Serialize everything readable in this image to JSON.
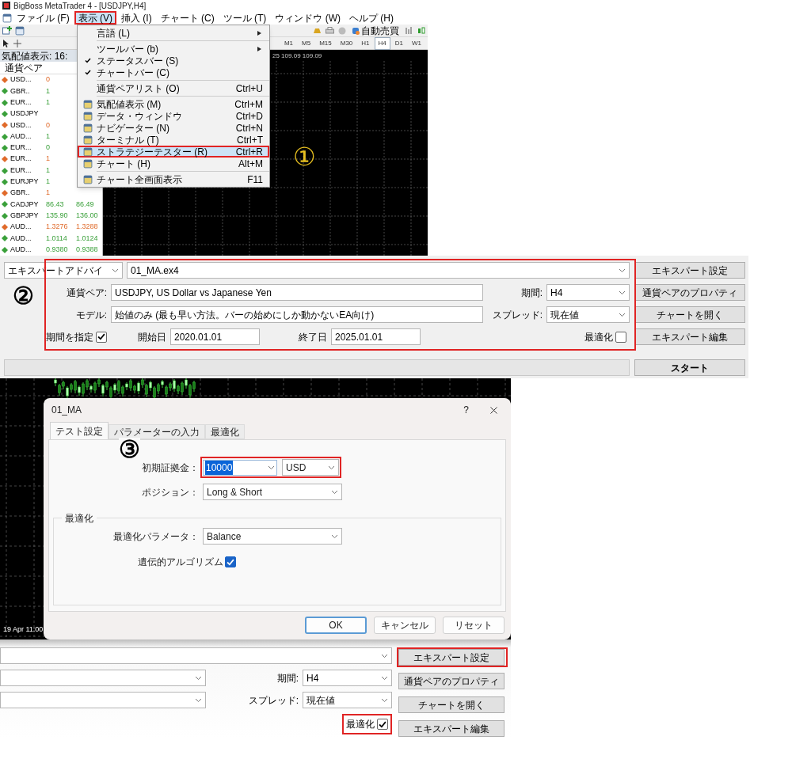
{
  "terminal": {
    "window": {
      "title": "BigBoss MetaTrader 4 - [USDJPY,H4]"
    },
    "menu_bar": [
      {
        "label": "ファイル (F)",
        "highlighted": false
      },
      {
        "label": "表示 (V)",
        "highlighted": true
      },
      {
        "label": "挿入 (I)",
        "highlighted": false
      },
      {
        "label": "チャート (C)",
        "highlighted": false
      },
      {
        "label": "ツール (T)",
        "highlighted": false
      },
      {
        "label": "ウィンドウ (W)",
        "highlighted": false
      },
      {
        "label": "ヘルプ (H)",
        "highlighted": false
      }
    ],
    "toolbar": {
      "auto_trade": "自動売買",
      "timeframes": [
        {
          "label": "M1",
          "selected": false
        },
        {
          "label": "M5",
          "selected": false
        },
        {
          "label": "M15",
          "selected": false
        },
        {
          "label": "M30",
          "selected": false
        },
        {
          "label": "H1",
          "selected": false
        },
        {
          "label": "H4",
          "selected": true
        },
        {
          "label": "D1",
          "selected": false
        },
        {
          "label": "W1",
          "selected": false
        }
      ]
    },
    "market_watch": {
      "title": "気配値表示: 16:",
      "column_1": "通貨ペア",
      "rows": [
        {
          "symbol": "USD...",
          "bid": "0",
          "color": "#e06a2a"
        },
        {
          "symbol": "GBR..",
          "bid": "1",
          "color": "#3aa03a"
        },
        {
          "symbol": "EUR...",
          "bid": "1",
          "color": "#3aa03a"
        },
        {
          "symbol": "USDJPY",
          "color": "#3aa03a"
        },
        {
          "symbol": "USD...",
          "bid": "0",
          "color": "#e06a2a"
        },
        {
          "symbol": "AUD...",
          "bid": "1",
          "color": "#3aa03a"
        },
        {
          "symbol": "EUR...",
          "bid": "0",
          "color": "#3aa03a"
        },
        {
          "symbol": "EUR...",
          "bid": "1",
          "color": "#e06a2a"
        },
        {
          "symbol": "EUR...",
          "bid": "1",
          "color": "#3aa03a"
        },
        {
          "symbol": "EURJPY",
          "bid": "1",
          "color": "#3aa03a"
        },
        {
          "symbol": "GBR..",
          "bid": "1",
          "color": "#e06a2a"
        },
        {
          "symbol": "CADJPY",
          "bid": "86.43",
          "ask": "86.49",
          "color": "#3aa03a"
        },
        {
          "symbol": "GBPJPY",
          "bid": "135.90",
          "ask": "136.00",
          "color": "#3aa03a"
        },
        {
          "symbol": "AUD...",
          "bid": "1.3276",
          "ask": "1.3288",
          "color": "#e06a2a"
        },
        {
          "symbol": "AUD...",
          "bid": "1.0114",
          "ask": "1.0124",
          "color": "#3aa03a"
        },
        {
          "symbol": "AUD...",
          "bid": "0.9380",
          "ask": "0.9388",
          "color": "#3aa03a"
        }
      ]
    },
    "chart": {
      "price_line": "25 109.09 109.09"
    },
    "view_menu": {
      "items": [
        {
          "kind": "submenu",
          "label": "言語 (L)",
          "checked": false,
          "icon": false,
          "selected": false,
          "highlighted": false
        },
        {
          "kind": "separator"
        },
        {
          "kind": "submenu",
          "label": "ツールバー (b)",
          "checked": false,
          "icon": false,
          "selected": false,
          "highlighted": false
        },
        {
          "kind": "item",
          "label": "ステータスバー (S)",
          "checked": true,
          "icon": false,
          "selected": false,
          "highlighted": false
        },
        {
          "kind": "item",
          "label": "チャートバー (C)",
          "checked": true,
          "icon": false,
          "selected": false,
          "highlighted": false
        },
        {
          "kind": "separator"
        },
        {
          "kind": "item",
          "label": "通貨ペアリスト (O)",
          "shortcut": "Ctrl+U",
          "checked": false,
          "icon": false,
          "selected": false,
          "highlighted": false
        },
        {
          "kind": "separator"
        },
        {
          "kind": "item",
          "label": "気配値表示 (M)",
          "shortcut": "Ctrl+M",
          "checked": false,
          "icon": true,
          "selected": false,
          "highlighted": false
        },
        {
          "kind": "item",
          "label": "データ・ウィンドウ",
          "shortcut": "Ctrl+D",
          "checked": false,
          "icon": true,
          "selected": false,
          "highlighted": false
        },
        {
          "kind": "item",
          "label": "ナビゲーター (N)",
          "shortcut": "Ctrl+N",
          "checked": false,
          "icon": true,
          "selected": false,
          "highlighted": false
        },
        {
          "kind": "item",
          "label": "ターミナル (T)",
          "shortcut": "Ctrl+T",
          "checked": false,
          "icon": true,
          "selected": false,
          "highlighted": false
        },
        {
          "kind": "item",
          "label": "ストラテジーテスター (R)",
          "shortcut": "Ctrl+R",
          "checked": false,
          "icon": true,
          "selected": true,
          "highlighted": true
        },
        {
          "kind": "item",
          "label": "チャート (H)",
          "shortcut": "Alt+M",
          "checked": false,
          "icon": true,
          "selected": false,
          "highlighted": false
        },
        {
          "kind": "separator"
        },
        {
          "kind": "item",
          "label": "チャート全画面表示",
          "shortcut": "F11",
          "checked": false,
          "icon": true,
          "selected": false,
          "highlighted": false
        }
      ]
    },
    "marker": "①"
  },
  "tester_panel": {
    "highlighted": true,
    "marker": "②",
    "expert_type": "エキスパートアドバイ",
    "expert": "01_MA.ex4",
    "symbol_label": "通貨ペア:",
    "symbol": "USDJPY, US Dollar vs Japanese Yen",
    "model_label": "モデル:",
    "model": "始値のみ (最も早い方法。バーの始めにしか動かないEA向け)",
    "period_label": "期間:",
    "period": "H4",
    "spread_label": "スプレッド:",
    "spread": "現在値",
    "use_date": {
      "label": "期間を指定",
      "checked": true
    },
    "start_label": "開始日",
    "start": "2020.01.01",
    "end_label": "終了日",
    "end": "2025.01.01",
    "optimization": {
      "label": "最適化",
      "checked": false
    },
    "buttons": [
      "エキスパート設定",
      "通貨ペアのプロパティ",
      "チャートを開く",
      "エキスパート編集"
    ],
    "start_button": "スタート",
    "progress": {
      "level": 0
    }
  },
  "background_chart": {
    "time_label": "19 Apr 11:00"
  },
  "settings_dialog": {
    "title": "01_MA",
    "help": "?",
    "marker": "③",
    "tabs": [
      {
        "label": "テスト設定",
        "selected": true
      },
      {
        "label": "パラメーターの入力",
        "selected": false
      },
      {
        "label": "最適化",
        "selected": false
      }
    ],
    "deposit_label": "初期証拠金：",
    "deposit": "10000",
    "currency": "USD",
    "deposit_highlighted": true,
    "position_label": "ポジション：",
    "position": "Long & Short",
    "group_title": "最適化",
    "opt_param_label": "最適化パラメータ：",
    "opt_param": "Balance",
    "genetic": {
      "label": "遺伝的アルゴリズム",
      "checked": true
    },
    "buttons": [
      {
        "label": "OK",
        "default": true
      },
      {
        "label": "キャンセル",
        "default": false
      },
      {
        "label": "リセット",
        "default": false
      }
    ]
  },
  "tester_panel_after": {
    "period_label": "期間:",
    "period": "H4",
    "spread_label": "スプレッド:",
    "spread": "現在値",
    "optimization": {
      "label": "最適化",
      "checked": true,
      "highlighted": true
    },
    "buttons": [
      {
        "label": "エキスパート設定",
        "highlighted": true
      },
      {
        "label": "通貨ペアのプロパティ",
        "highlighted": false
      },
      {
        "label": "チャートを開く",
        "highlighted": false
      },
      {
        "label": "エキスパート編集",
        "highlighted": false
      }
    ]
  }
}
